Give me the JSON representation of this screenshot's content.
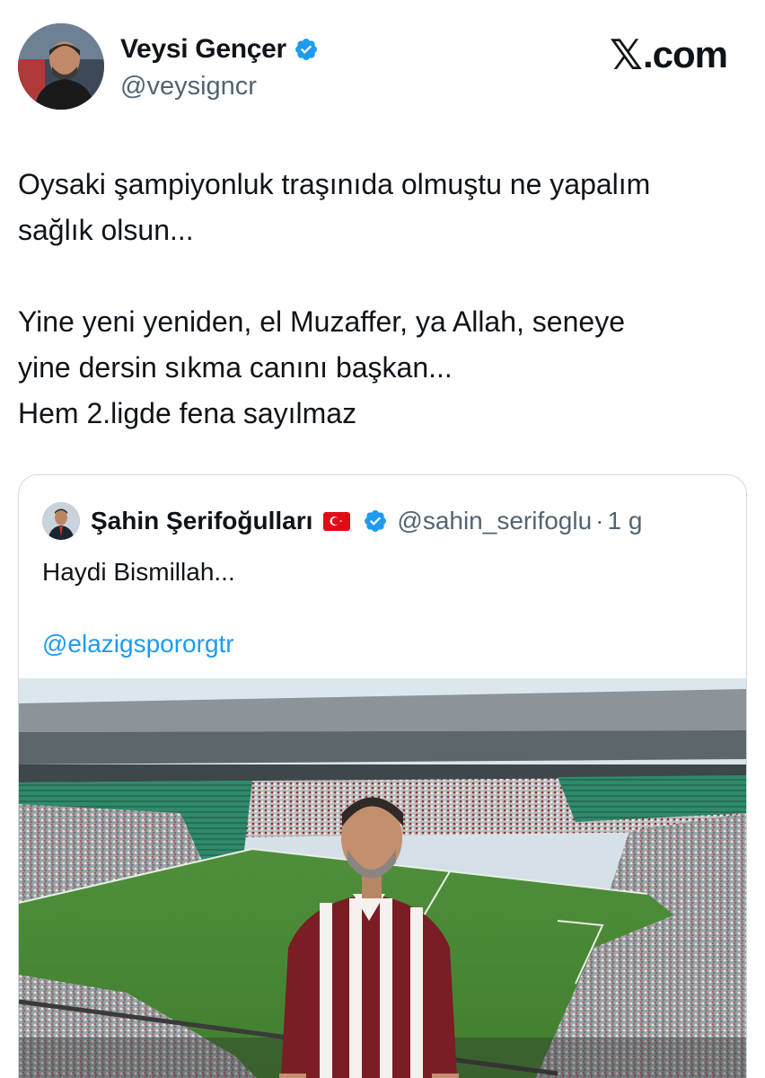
{
  "author": {
    "display_name": "Veysi Gençer",
    "handle": "@veysigncr",
    "verified": true
  },
  "brand": {
    "x_mark": "𝕏",
    "label": ".com"
  },
  "tweet": {
    "text": "Oysaki şampiyonluk traşınıda olmuştu ne yapalım\nsağlık olsun...\n\nYine yeni yeniden, el Muzaffer, ya Allah, seneye\nyine dersin sıkma canını başkan...\nHem 2.ligde fena sayılmaz"
  },
  "quoted_tweet": {
    "display_name": "Şahin Şerifoğulları",
    "flag": "turkey-flag",
    "verified": true,
    "handle": "@sahin_serifoglu",
    "separator": "·",
    "time": "1 g",
    "text": "Haydi Bismillah...",
    "mention": "@elazigspororgtr"
  },
  "colors": {
    "verified_blue": "#1d9bf0",
    "link_blue": "#1d9bf0",
    "secondary_text": "#536471",
    "border": "#cfd9de"
  }
}
